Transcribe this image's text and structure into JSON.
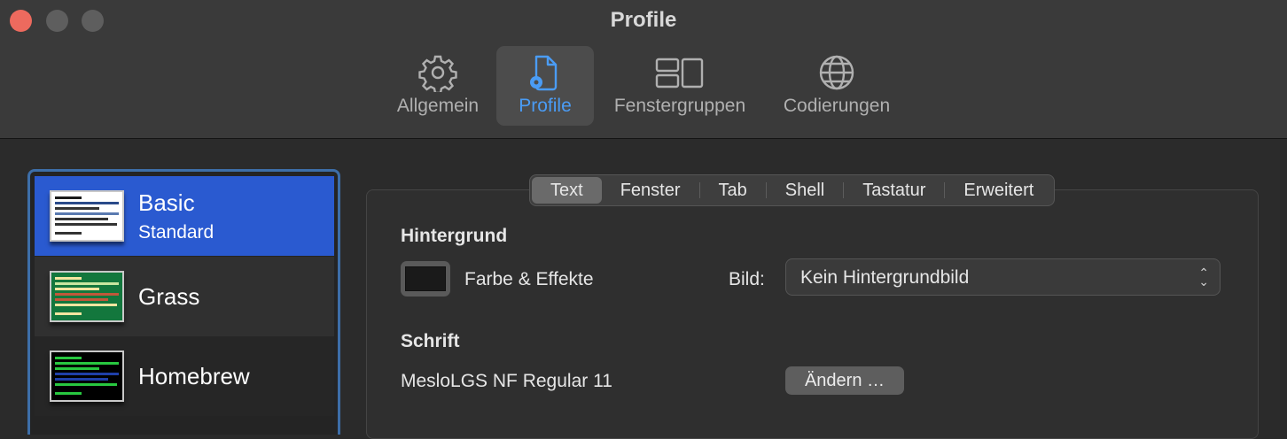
{
  "window": {
    "title": "Profile"
  },
  "toolbar": {
    "items": [
      {
        "label": "Allgemein",
        "icon": "gear-icon"
      },
      {
        "label": "Profile",
        "icon": "document-gear-icon",
        "selected": true
      },
      {
        "label": "Fenstergruppen",
        "icon": "window-groups-icon"
      },
      {
        "label": "Codierungen",
        "icon": "globe-icon"
      }
    ]
  },
  "colors": {
    "accent": "#4a9cf5",
    "selection": "#2a5ad0",
    "close": "#ed6a5e"
  },
  "profiles": [
    {
      "name": "Basic",
      "subtitle": "Standard",
      "selected": true
    },
    {
      "name": "Grass",
      "subtitle": ""
    },
    {
      "name": "Homebrew",
      "subtitle": ""
    }
  ],
  "tabs": [
    "Text",
    "Fenster",
    "Tab",
    "Shell",
    "Tastatur",
    "Erweitert"
  ],
  "selected_tab": "Text",
  "background": {
    "title": "Hintergrund",
    "color_label": "Farbe & Effekte",
    "image_label": "Bild:",
    "image_value": "Kein Hintergrundbild"
  },
  "font": {
    "title": "Schrift",
    "value": "MesloLGS NF Regular 11",
    "change_button": "Ändern …"
  }
}
